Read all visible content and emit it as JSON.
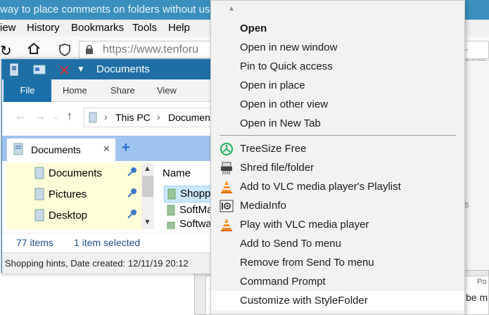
{
  "browser": {
    "title": "way to place comments on folders without us",
    "menu": [
      {
        "label": "iew"
      },
      {
        "label": "History"
      },
      {
        "label": "Bookmarks"
      },
      {
        "label": "Tools"
      },
      {
        "label": "Help"
      }
    ],
    "url": "https://www.tenforu",
    "url_right": "-com"
  },
  "explorer": {
    "title": "Documents",
    "ribbon_tabs": [
      "File",
      "Home",
      "Share",
      "View"
    ],
    "breadcrumb": [
      "This PC",
      "Documen"
    ],
    "doc_tab_label": "Documents",
    "nav_items": [
      {
        "label": "Documents"
      },
      {
        "label": "Pictures"
      },
      {
        "label": "Desktop"
      }
    ],
    "column_header": "Name",
    "files": [
      {
        "name": "Shoppi"
      },
      {
        "name": "SoftMa"
      },
      {
        "name": "Softwa"
      }
    ],
    "status_count": "77 items",
    "status_selected": "1 item selected",
    "status_detail": "Shopping hints, Date created: 12/11/19 20:12"
  },
  "context_menu": {
    "items_top": [
      {
        "label": "Open"
      },
      {
        "label": "Open in new window"
      },
      {
        "label": "Pin to Quick access"
      },
      {
        "label": "Open in place"
      },
      {
        "label": "Open in other view"
      },
      {
        "label": "Open in New Tab"
      }
    ],
    "items_bottom": [
      {
        "label": "TreeSize Free",
        "icon": "treesize-icon"
      },
      {
        "label": "Shred file/folder",
        "icon": "shredder-icon"
      },
      {
        "label": "Add to VLC media player's Playlist",
        "icon": "vlc-icon"
      },
      {
        "label": "MediaInfo",
        "icon": "mediainfo-icon"
      },
      {
        "label": "Play with VLC media player",
        "icon": "vlc-icon"
      },
      {
        "label": "Add to Send To menu"
      },
      {
        "label": "Remove from Send To menu"
      },
      {
        "label": "Command Prompt"
      },
      {
        "label": "Customize with StyleFolder"
      }
    ]
  },
  "behind_text": {
    "right_fragment_1": "s",
    "right_fragment_2": "be m",
    "right_fragment_3": "Po"
  },
  "colors": {
    "title_bar": "#1f6fa5",
    "file_tab": "#1a6fa8",
    "tab_strip": "#9fc3ef",
    "nav_pane": "#fdfdd8",
    "menu_bg": "#f2f2f2",
    "menu_hover": "#ffffff"
  }
}
